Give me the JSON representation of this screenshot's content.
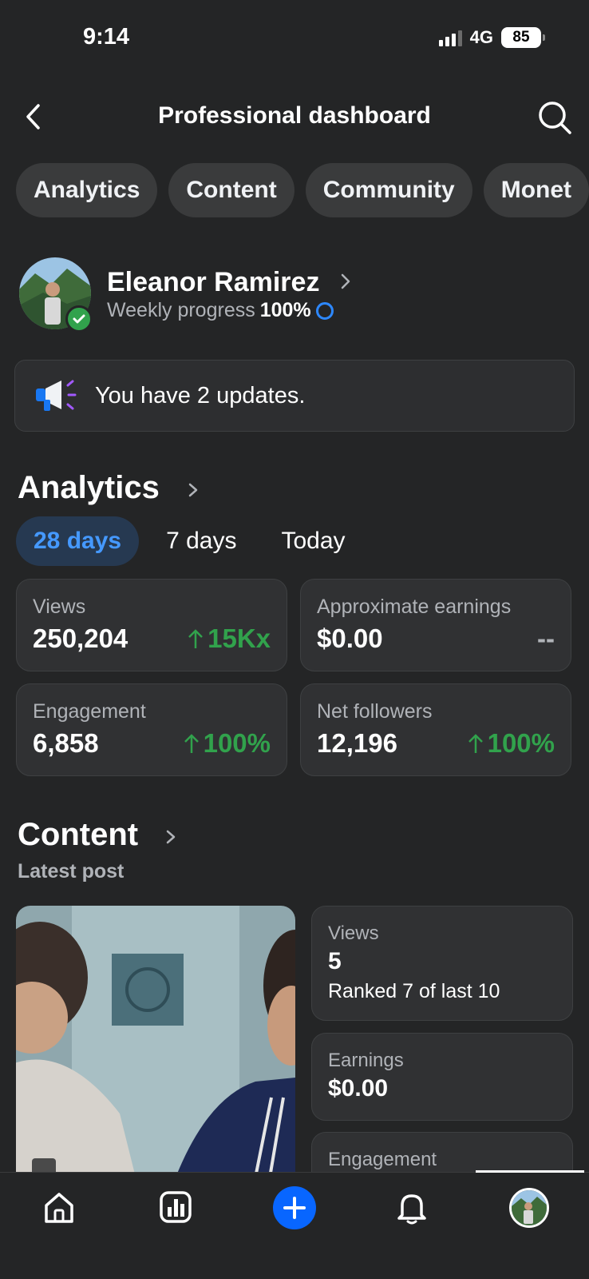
{
  "status_bar": {
    "time": "9:14",
    "network": "4G",
    "battery": "85"
  },
  "header": {
    "title": "Professional dashboard"
  },
  "tabs": [
    {
      "label": "Analytics"
    },
    {
      "label": "Content"
    },
    {
      "label": "Community"
    },
    {
      "label": "Monet"
    }
  ],
  "profile": {
    "name": "Eleanor Ramirez",
    "progress_label": "Weekly progress",
    "progress_value": "100%",
    "progress_fraction": 1.0
  },
  "updates": {
    "text": "You have 2 updates."
  },
  "analytics": {
    "title": "Analytics",
    "ranges": [
      "28 days",
      "7 days",
      "Today"
    ],
    "active_range": "28 days",
    "stats": [
      {
        "label": "Views",
        "value": "250,204",
        "delta": "15Kx",
        "trend": "up"
      },
      {
        "label": "Approximate earnings",
        "value": "$0.00",
        "delta": "--",
        "trend": "none"
      },
      {
        "label": "Engagement",
        "value": "6,858",
        "delta": "100%",
        "trend": "up"
      },
      {
        "label": "Net followers",
        "value": "12,196",
        "delta": "100%",
        "trend": "up"
      }
    ]
  },
  "content": {
    "title": "Content",
    "subtitle": "Latest post",
    "metrics": [
      {
        "label": "Views",
        "value": "5",
        "note": "Ranked 7 of last 10"
      },
      {
        "label": "Earnings",
        "value": "$0.00"
      },
      {
        "label": "Engagement"
      }
    ]
  },
  "colors": {
    "background": "#242526",
    "card": "#303133",
    "accent": "#0866ff",
    "positive": "#31a24c",
    "active_range_bg": "#263951"
  },
  "bottom_nav": [
    "home-icon",
    "insights-icon",
    "create-icon",
    "notifications-icon",
    "profile-avatar"
  ]
}
